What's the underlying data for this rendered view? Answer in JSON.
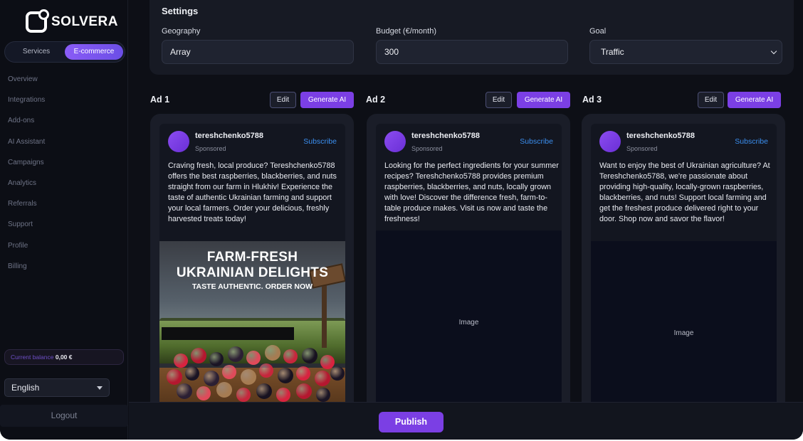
{
  "brand": {
    "name": "SOLVERA"
  },
  "mode_toggle": {
    "services_label": "Services",
    "ecommerce_label": "E-commerce",
    "active": "E-commerce"
  },
  "sidebar": {
    "items": [
      {
        "label": "Overview"
      },
      {
        "label": "Integrations"
      },
      {
        "label": "Add-ons"
      },
      {
        "label": "AI Assistant"
      },
      {
        "label": "Campaigns"
      },
      {
        "label": "Analytics"
      },
      {
        "label": "Referrals"
      },
      {
        "label": "Support"
      },
      {
        "label": "Profile"
      },
      {
        "label": "Billing"
      }
    ],
    "balance_label": "Current balance",
    "balance_value": "0,00 €",
    "language": "English",
    "logout_label": "Logout"
  },
  "settings": {
    "title": "Settings",
    "geography_label": "Geography",
    "geography_value": "Array",
    "budget_label": "Budget (€/month)",
    "budget_value": "300",
    "goal_label": "Goal",
    "goal_value": "Traffic"
  },
  "ads": [
    {
      "title": "Ad 1",
      "edit_label": "Edit",
      "generate_label": "Generate AI",
      "username": "tereshchenko5788",
      "sponsored": "Sponsored",
      "subscribe": "Subscribe",
      "text": "Craving fresh, local produce? Tereshchenko5788 offers the best raspberries, blackberries, and nuts straight from our farm in Hlukhiv! Experience the taste of authentic Ukrainian farming and support your local farmers. Order your delicious, freshly harvested treats today!",
      "image": {
        "headline_1": "FARM-FRESH",
        "headline_2": "UKRAINIAN DELIGHTS",
        "tagline": "TASTE AUTHENTIC. ORDER NOW"
      }
    },
    {
      "title": "Ad 2",
      "edit_label": "Edit",
      "generate_label": "Generate AI",
      "username": "tereshchenko5788",
      "sponsored": "Sponsored",
      "subscribe": "Subscribe",
      "text": "Looking for the perfect ingredients for your summer recipes? Tereshchenko5788 provides premium raspberries, blackberries, and nuts, locally grown with love! Discover the difference fresh, farm-to-table produce makes. Visit us now and taste the freshness!",
      "image_placeholder": "Image"
    },
    {
      "title": "Ad 3",
      "edit_label": "Edit",
      "generate_label": "Generate AI",
      "username": "tereshchenko5788",
      "sponsored": "Sponsored",
      "subscribe": "Subscribe",
      "text": "Want to enjoy the best of Ukrainian agriculture? At Tereshchenko5788, we're passionate about providing high-quality, locally-grown raspberries, blackberries, and nuts! Support local farming and get the freshest produce delivered right to your door. Shop now and savor the flavor!",
      "image_placeholder": "Image"
    }
  ],
  "footer": {
    "publish_label": "Publish"
  },
  "colors": {
    "accent": "#7b3fe4",
    "link": "#3b8ff0",
    "background": "#0d0f16",
    "panel": "#171a24"
  }
}
